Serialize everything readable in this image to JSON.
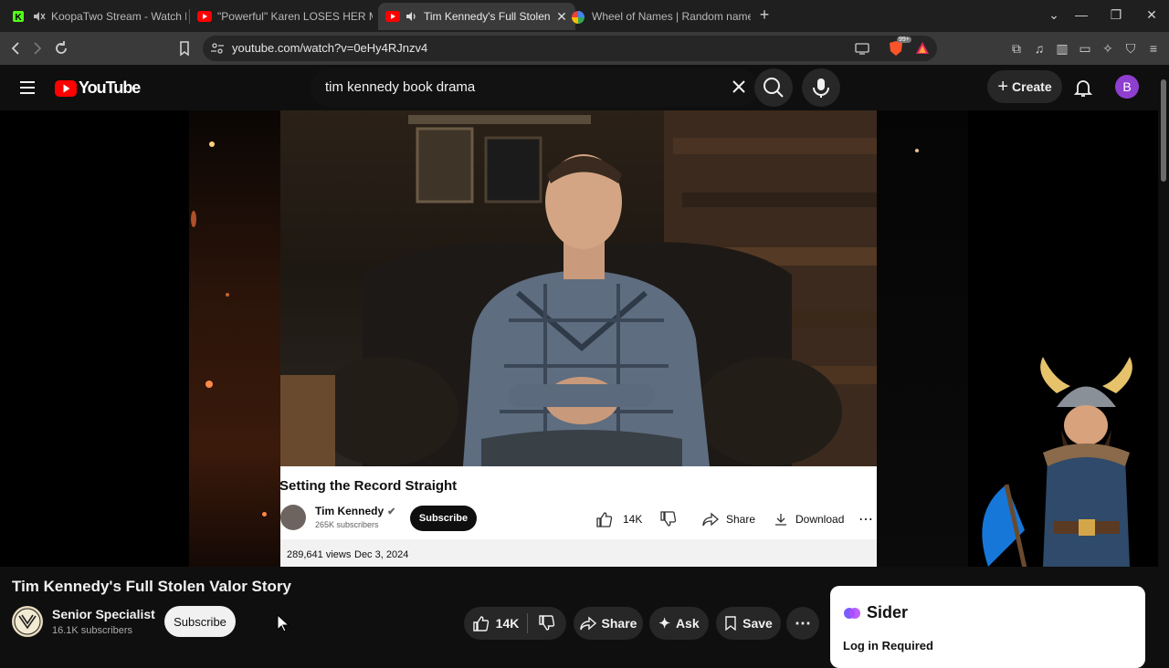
{
  "browser": {
    "tabs": [
      {
        "title": "KoopaTwo Stream - Watch Live o",
        "favicon": "kick-icon"
      },
      {
        "title": "\"Powerful\" Karen LOSES HER MIND V",
        "favicon": "youtube-icon"
      },
      {
        "title": "Tim Kennedy's Full Stolen Val",
        "favicon": "youtube-icon",
        "active": true
      },
      {
        "title": "Wheel of Names | Random name pic",
        "favicon": "wheel-icon"
      }
    ],
    "url": "youtube.com/watch?v=0eHy4RJnzv4",
    "shield_badge": "99+"
  },
  "youtube": {
    "logo_text": "YouTube",
    "search_query": "tim kennedy book drama",
    "create_label": "Create",
    "avatar_letter": "B"
  },
  "embedded_video": {
    "title": "Setting the Record Straight",
    "channel": "Tim Kennedy",
    "subscribers": "265K subscribers",
    "subscribe_label": "Subscribe",
    "likes": "14K",
    "share_label": "Share",
    "download_label": "Download",
    "views": "289,641 views",
    "date": "Dec 3, 2024"
  },
  "video": {
    "title": "Tim Kennedy's Full Stolen Valor Story",
    "channel": "Senior Specialist",
    "subscribers": "16.1K subscribers",
    "subscribe_label": "Subscribe",
    "likes": "14K",
    "share_label": "Share",
    "ask_label": "Ask",
    "save_label": "Save"
  },
  "sider": {
    "brand": "Sider",
    "message": "Log in Required"
  },
  "colors": {
    "youtube_red": "#ff0000",
    "sider_purple": "#7c5cff",
    "avatar_purple": "#8e3fd0"
  }
}
